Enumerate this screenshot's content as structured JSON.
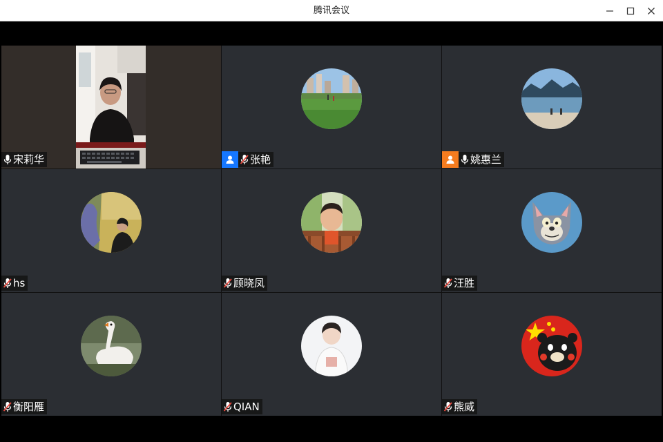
{
  "window": {
    "title": "腾讯会议",
    "controls": {
      "minimize_icon": "minimize-icon",
      "maximize_icon": "maximize-icon",
      "close_icon": "close-icon"
    }
  },
  "colors": {
    "tile_bg": "#2b2e33",
    "host_badge": "#1677ff",
    "cohost_badge": "#f57c1f",
    "muted_mic": "#e84a3f"
  },
  "participants": [
    {
      "name": "宋莉华",
      "mic": "on",
      "video": true,
      "badge": ""
    },
    {
      "name": "张艳",
      "mic": "muted",
      "video": false,
      "badge": "host",
      "avatar": "park-photo"
    },
    {
      "name": "姚惠兰",
      "mic": "on",
      "video": false,
      "badge": "cohost",
      "avatar": "beach-photo"
    },
    {
      "name": "hs",
      "mic": "muted",
      "video": false,
      "badge": "",
      "avatar": "temple-photo"
    },
    {
      "name": "顾晓凤",
      "mic": "muted",
      "video": false,
      "badge": "",
      "avatar": "child-photo"
    },
    {
      "name": "汪胜",
      "mic": "muted",
      "video": false,
      "badge": "",
      "avatar": "cartoon-cat"
    },
    {
      "name": "衡阳雁",
      "mic": "muted",
      "video": false,
      "badge": "",
      "avatar": "swan-photo"
    },
    {
      "name": "QIAN",
      "mic": "muted",
      "video": false,
      "badge": "",
      "avatar": "boy-photo"
    },
    {
      "name": "熊威",
      "mic": "muted",
      "video": false,
      "badge": "",
      "avatar": "bear-flag"
    }
  ]
}
